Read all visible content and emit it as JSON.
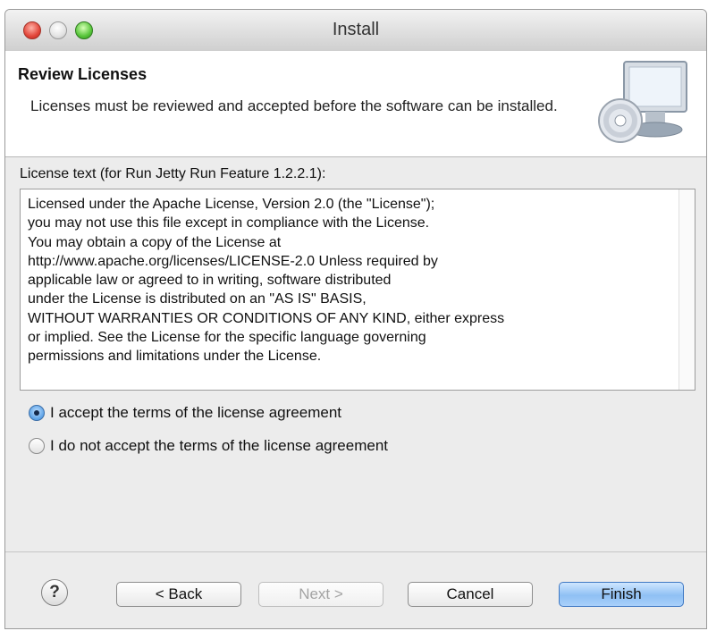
{
  "window": {
    "title": "Install"
  },
  "header": {
    "title": "Review Licenses",
    "description": "Licenses must be reviewed and accepted before the software can be installed.",
    "graphic_icon": "install-computer-cd-icon"
  },
  "license": {
    "label": "License text (for Run Jetty Run Feature 1.2.2.1):",
    "text": "Licensed under the Apache License, Version 2.0 (the \"License\");\nyou may not use this file except in compliance with the License.\nYou may obtain a copy of the License at\nhttp://www.apache.org/licenses/LICENSE-2.0 Unless required by\napplicable law or agreed to in writing, software distributed\nunder the License is distributed on an \"AS IS\" BASIS,\nWITHOUT WARRANTIES OR CONDITIONS OF ANY KIND, either express\nor implied. See the License for the specific language governing\npermissions and limitations under the License."
  },
  "options": {
    "accept": {
      "label": "I accept the terms of the license agreement",
      "selected": true
    },
    "decline": {
      "label": "I do not accept the terms of the license agreement",
      "selected": false
    }
  },
  "buttons": {
    "help": "?",
    "back": "< Back",
    "next": "Next >",
    "cancel": "Cancel",
    "finish": "Finish"
  },
  "colors": {
    "default_button": "#8fc0f4",
    "close": "#e2463a",
    "minimize": "#e3e3e3",
    "zoom": "#57c53a"
  }
}
